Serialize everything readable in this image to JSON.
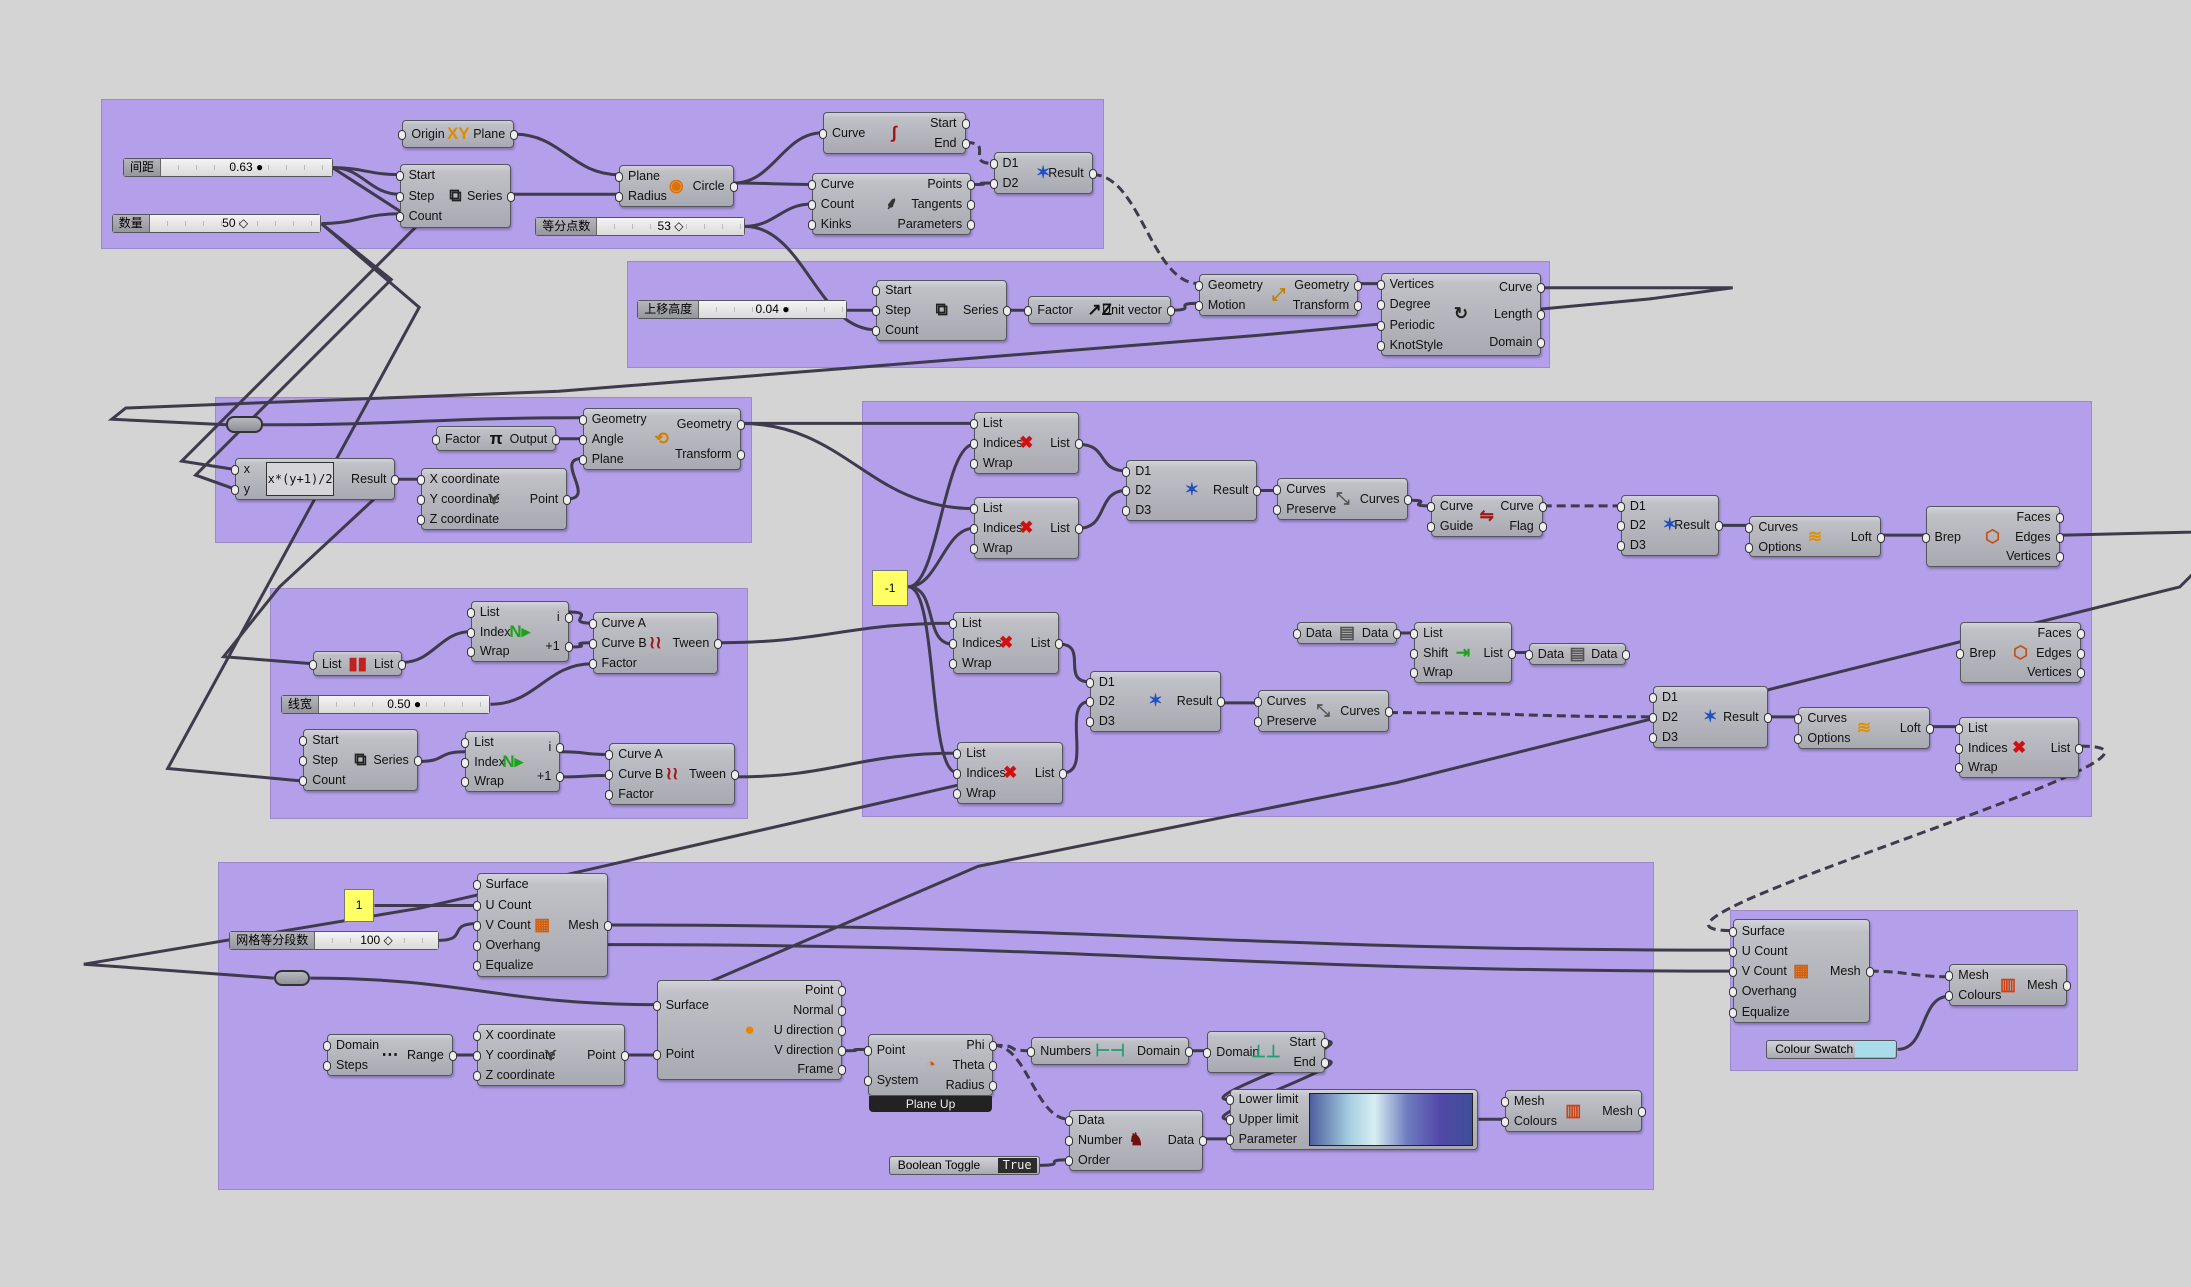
{
  "canvas": {
    "background": "#d4d4d4",
    "group_color": "#b39fea",
    "wire_color": "#3f3a4c"
  },
  "sliders": [
    {
      "id": "s_spacing",
      "label": "间距",
      "value": "0.63",
      "marker": "circle"
    },
    {
      "id": "s_count",
      "label": "数量",
      "value": "50",
      "marker": "diamond"
    },
    {
      "id": "s_divide",
      "label": "等分点数",
      "value": "53",
      "marker": "diamond"
    },
    {
      "id": "s_lift",
      "label": "上移高度",
      "value": "0.04",
      "marker": "circle"
    },
    {
      "id": "s_width",
      "label": "线宽",
      "value": "0.50",
      "marker": "circle"
    },
    {
      "id": "s_mesh",
      "label": "网格等分段数",
      "value": "100",
      "marker": "diamond"
    }
  ],
  "nodes": [
    {
      "id": "xy_plane",
      "inputs": [
        "Origin"
      ],
      "outputs": [
        "Plane"
      ],
      "icon": "xy-plane-icon"
    },
    {
      "id": "series1",
      "inputs": [
        "Start",
        "Step",
        "Count"
      ],
      "outputs": [
        "Series"
      ],
      "icon": "series-icon"
    },
    {
      "id": "circle",
      "inputs": [
        "Plane",
        "Radius"
      ],
      "outputs": [
        "Circle"
      ],
      "icon": "circle-icon"
    },
    {
      "id": "end_points",
      "inputs": [
        "Curve"
      ],
      "outputs": [
        "Start",
        "End"
      ],
      "icon": "end-points-icon"
    },
    {
      "id": "divide_curve",
      "inputs": [
        "Curve",
        "Count",
        "Kinks"
      ],
      "outputs": [
        "Points",
        "Tangents",
        "Parameters"
      ],
      "icon": "divide-curve-icon"
    },
    {
      "id": "merge1",
      "inputs": [
        "D1",
        "D2"
      ],
      "outputs": [
        "Result"
      ],
      "icon": "merge-icon"
    },
    {
      "id": "series2",
      "inputs": [
        "Start",
        "Step",
        "Count"
      ],
      "outputs": [
        "Series"
      ],
      "icon": "series-icon"
    },
    {
      "id": "unit_z",
      "inputs": [
        "Factor"
      ],
      "outputs": [
        "Unit vector"
      ],
      "icon": "unit-z-icon"
    },
    {
      "id": "move",
      "inputs": [
        "Geometry",
        "Motion"
      ],
      "outputs": [
        "Geometry",
        "Transform"
      ],
      "icon": "move-icon"
    },
    {
      "id": "nurbs",
      "inputs": [
        "Vertices",
        "Degree",
        "Periodic",
        "KnotStyle"
      ],
      "outputs": [
        "Curve",
        "Length",
        "Domain"
      ],
      "icon": "nurbs-curve-icon"
    },
    {
      "id": "pi",
      "inputs": [
        "Factor"
      ],
      "outputs": [
        "Output"
      ],
      "icon": "pi-icon"
    },
    {
      "id": "rotate",
      "inputs": [
        "Geometry",
        "Angle",
        "Plane"
      ],
      "outputs": [
        "Geometry",
        "Transform"
      ],
      "icon": "rotate-icon"
    },
    {
      "id": "expression",
      "inputs": [
        "x",
        "y"
      ],
      "outputs": [
        "Result"
      ],
      "icon": "expression-icon",
      "expression": "x*(y+1)/2"
    },
    {
      "id": "point1",
      "inputs": [
        "X coordinate",
        "Y coordinate",
        "Z coordinate"
      ],
      "outputs": [
        "Point"
      ],
      "icon": "construct-point-icon"
    },
    {
      "id": "list_item1",
      "inputs": [
        "List",
        "Index",
        "Wrap"
      ],
      "outputs": [
        "i",
        "+1"
      ],
      "icon": "list-item-icon"
    },
    {
      "id": "reverse",
      "inputs": [
        "List"
      ],
      "outputs": [
        "List"
      ],
      "icon": "reverse-list-icon"
    },
    {
      "id": "tween1",
      "inputs": [
        "Curve A",
        "Curve B",
        "Factor"
      ],
      "outputs": [
        "Tween"
      ],
      "icon": "tween-curve-icon"
    },
    {
      "id": "series3",
      "inputs": [
        "Start",
        "Step",
        "Count"
      ],
      "outputs": [
        "Series"
      ],
      "icon": "series-icon"
    },
    {
      "id": "list_item2",
      "inputs": [
        "List",
        "Index",
        "Wrap"
      ],
      "outputs": [
        "i",
        "+1"
      ],
      "icon": "list-item-icon"
    },
    {
      "id": "tween2",
      "inputs": [
        "Curve A",
        "Curve B",
        "Factor"
      ],
      "outputs": [
        "Tween"
      ],
      "icon": "tween-curve-icon"
    },
    {
      "id": "cull1",
      "inputs": [
        "List",
        "Indices",
        "Wrap"
      ],
      "outputs": [
        "List"
      ],
      "icon": "cull-index-icon"
    },
    {
      "id": "cull2",
      "inputs": [
        "List",
        "Indices",
        "Wrap"
      ],
      "outputs": [
        "List"
      ],
      "icon": "cull-index-icon"
    },
    {
      "id": "merge2",
      "inputs": [
        "D1",
        "D2",
        "D3"
      ],
      "outputs": [
        "Result"
      ],
      "icon": "merge-icon"
    },
    {
      "id": "join1",
      "inputs": [
        "Curves",
        "Preserve"
      ],
      "outputs": [
        "Curves"
      ],
      "icon": "join-curves-icon"
    },
    {
      "id": "flip",
      "inputs": [
        "Curve",
        "Guide"
      ],
      "outputs": [
        "Curve",
        "Flag"
      ],
      "icon": "flip-curve-icon"
    },
    {
      "id": "merge3",
      "inputs": [
        "D1",
        "D2",
        "D3"
      ],
      "outputs": [
        "Result"
      ],
      "icon": "merge-icon"
    },
    {
      "id": "loft1",
      "inputs": [
        "Curves",
        "Options"
      ],
      "outputs": [
        "Loft"
      ],
      "icon": "loft-icon"
    },
    {
      "id": "brep1",
      "inputs": [
        "Brep"
      ],
      "outputs": [
        "Faces",
        "Edges",
        "Vertices"
      ],
      "icon": "deconstruct-brep-icon"
    },
    {
      "id": "cull3",
      "inputs": [
        "List",
        "Indices",
        "Wrap"
      ],
      "outputs": [
        "List"
      ],
      "icon": "cull-index-icon"
    },
    {
      "id": "data1",
      "inputs": [
        "Data"
      ],
      "outputs": [
        "Data"
      ],
      "icon": "data-icon"
    },
    {
      "id": "shift",
      "inputs": [
        "List",
        "Shift",
        "Wrap"
      ],
      "outputs": [
        "List"
      ],
      "icon": "shift-list-icon"
    },
    {
      "id": "data2",
      "inputs": [
        "Data"
      ],
      "outputs": [
        "Data"
      ],
      "icon": "data-icon"
    },
    {
      "id": "merge4",
      "inputs": [
        "D1",
        "D2",
        "D3"
      ],
      "outputs": [
        "Result"
      ],
      "icon": "merge-icon"
    },
    {
      "id": "join2",
      "inputs": [
        "Curves",
        "Preserve"
      ],
      "outputs": [
        "Curves"
      ],
      "icon": "join-curves-icon"
    },
    {
      "id": "merge5",
      "inputs": [
        "D1",
        "D2",
        "D3"
      ],
      "outputs": [
        "Result"
      ],
      "icon": "merge-icon"
    },
    {
      "id": "loft2",
      "inputs": [
        "Curves",
        "Options"
      ],
      "outputs": [
        "Loft"
      ],
      "icon": "loft-icon"
    },
    {
      "id": "brep2",
      "inputs": [
        "Brep"
      ],
      "outputs": [
        "Faces",
        "Edges",
        "Vertices"
      ],
      "icon": "deconstruct-brep-icon"
    },
    {
      "id": "cull4",
      "inputs": [
        "List",
        "Indices",
        "Wrap"
      ],
      "outputs": [
        "List"
      ],
      "icon": "cull-index-icon"
    },
    {
      "id": "cull5",
      "inputs": [
        "List",
        "Indices",
        "Wrap"
      ],
      "outputs": [
        "List"
      ],
      "icon": "cull-index-icon"
    },
    {
      "id": "mesh_surface1",
      "inputs": [
        "Surface",
        "U Count",
        "V Count",
        "Overhang",
        "Equalize"
      ],
      "outputs": [
        "Mesh"
      ],
      "icon": "mesh-surface-icon"
    },
    {
      "id": "eval_surface",
      "inputs": [
        "Surface",
        "Point"
      ],
      "outputs": [
        "Point",
        "Normal",
        "U direction",
        "V direction",
        "Frame"
      ],
      "icon": "evaluate-surface-icon"
    },
    {
      "id": "range",
      "inputs": [
        "Domain",
        "Steps"
      ],
      "outputs": [
        "Range"
      ],
      "icon": "range-icon"
    },
    {
      "id": "point2",
      "inputs": [
        "X coordinate",
        "Y coordinate",
        "Z coordinate"
      ],
      "outputs": [
        "Point"
      ],
      "icon": "construct-point-icon"
    },
    {
      "id": "plane_coords",
      "inputs": [
        "Point",
        "System"
      ],
      "outputs": [
        "Phi",
        "Theta",
        "Radius"
      ],
      "icon": "plane-coordinates-icon",
      "footer": "Plane Up"
    },
    {
      "id": "bounds",
      "inputs": [
        "Numbers"
      ],
      "outputs": [
        "Domain"
      ],
      "icon": "bounds-icon"
    },
    {
      "id": "deconstruct_domain",
      "inputs": [
        "Domain"
      ],
      "outputs": [
        "Start",
        "End"
      ],
      "icon": "deconstruct-domain-icon"
    },
    {
      "id": "sort",
      "inputs": [
        "Data",
        "Number",
        "Order"
      ],
      "outputs": [
        "Data"
      ],
      "icon": "sort-icon"
    },
    {
      "id": "gradient",
      "inputs": [
        "Lower limit",
        "Upper limit",
        "Parameter"
      ],
      "outputs": [],
      "icon": "gradient-icon"
    },
    {
      "id": "mesh_colours1",
      "inputs": [
        "Mesh",
        "Colours"
      ],
      "outputs": [
        "Mesh"
      ],
      "icon": "mesh-colours-icon"
    },
    {
      "id": "mesh_surface2",
      "inputs": [
        "Surface",
        "U Count",
        "V Count",
        "Overhang",
        "Equalize"
      ],
      "outputs": [
        "Mesh"
      ],
      "icon": "mesh-surface-icon"
    },
    {
      "id": "mesh_colours2",
      "inputs": [
        "Mesh",
        "Colours"
      ],
      "outputs": [
        "Mesh"
      ],
      "icon": "mesh-colours-icon"
    }
  ],
  "panels": [
    {
      "id": "panel_neg1",
      "value": "-1"
    },
    {
      "id": "panel_1",
      "value": "1"
    }
  ],
  "toggle": {
    "label": "Boolean Toggle",
    "value": "True"
  },
  "swatch": {
    "label": "Colour Swatch",
    "color": "#a9dcea"
  }
}
